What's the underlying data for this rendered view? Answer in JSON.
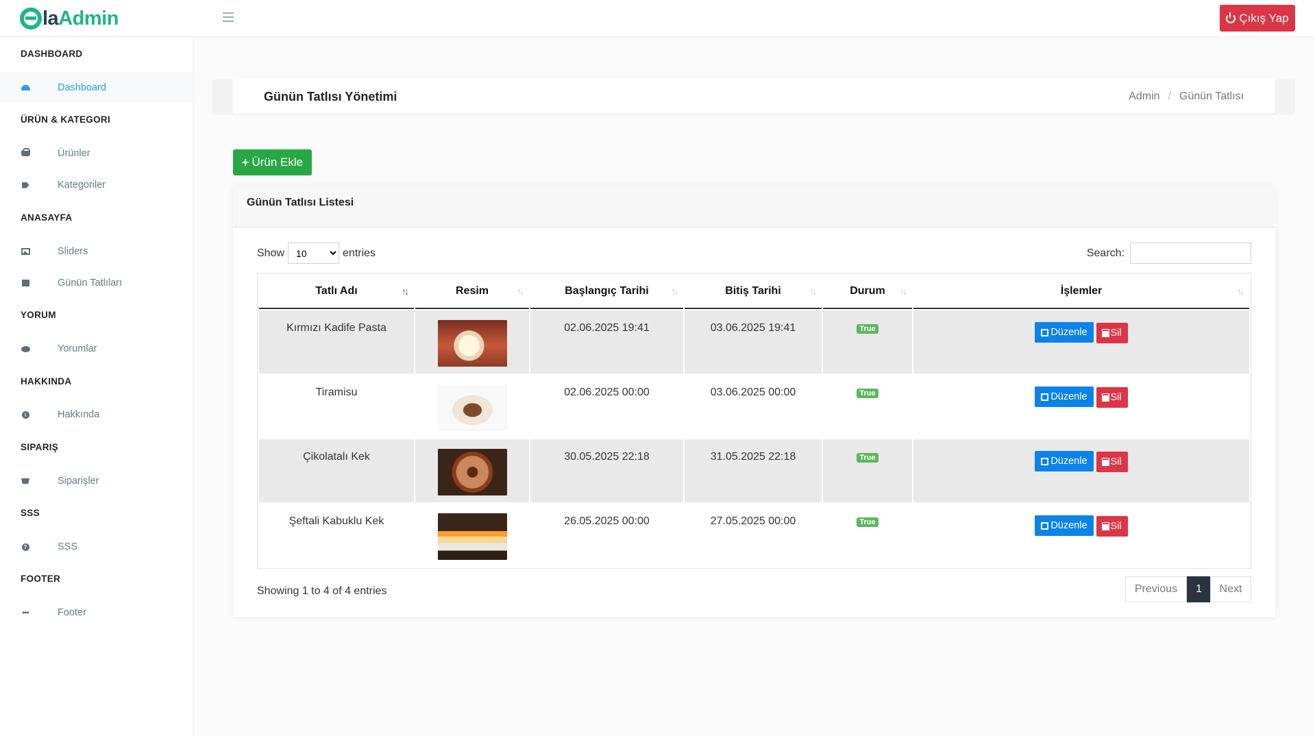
{
  "app": {
    "logo_la": "la",
    "logo_admin": "Admin",
    "logout_label": "Çıkış Yap"
  },
  "sidebar": {
    "sections": [
      {
        "caption": "DASHBOARD",
        "items": [
          {
            "label": "Dashboard",
            "icon": "gauge-icon",
            "active": true
          }
        ]
      },
      {
        "caption": "ÜRÜN & KATEGORI",
        "items": [
          {
            "label": "Ürünler",
            "icon": "basket-icon"
          },
          {
            "label": "Kategoriler",
            "icon": "tags-icon"
          }
        ]
      },
      {
        "caption": "ANASAYFA",
        "items": [
          {
            "label": "Sliders",
            "icon": "image-icon"
          },
          {
            "label": "Günün Tatlıları",
            "icon": "gift-icon"
          }
        ]
      },
      {
        "caption": "YORUM",
        "items": [
          {
            "label": "Yorumlar",
            "icon": "comments-icon"
          }
        ]
      },
      {
        "caption": "HAKKINDA",
        "items": [
          {
            "label": "Hakkında",
            "icon": "info-icon"
          }
        ]
      },
      {
        "caption": "SIPARIŞ",
        "items": [
          {
            "label": "Siparişler",
            "icon": "cart-icon"
          }
        ]
      },
      {
        "caption": "SSS",
        "items": [
          {
            "label": "SSS",
            "icon": "question-icon"
          }
        ]
      },
      {
        "caption": "FOOTER",
        "items": [
          {
            "label": "Footer",
            "icon": "ellipsis-icon"
          }
        ]
      }
    ]
  },
  "page": {
    "title": "Günün Tatlısı Yönetimi",
    "breadcrumb": [
      "Admin",
      "Günün Tatlısı"
    ],
    "add_button": "Ürün Ekle",
    "card_title": "Günün Tatlısı Listesi"
  },
  "datatable": {
    "show_label": "Show",
    "entries_label": "entries",
    "length_value": "10",
    "search_label": "Search:",
    "search_value": "",
    "columns": [
      "Tatlı Adı",
      "Resim",
      "Başlangıç Tarihi",
      "Bitiş Tarihi",
      "Durum",
      "İşlemler"
    ],
    "rows": [
      {
        "name": "Kırmızı Kadife Pasta",
        "start": "02.06.2025 19:41",
        "end": "03.06.2025 19:41",
        "status": "True"
      },
      {
        "name": "Tiramisu",
        "start": "02.06.2025 00:00",
        "end": "03.06.2025 00:00",
        "status": "True"
      },
      {
        "name": "Çikolatalı Kek",
        "start": "30.05.2025 22:18",
        "end": "31.05.2025 22:18",
        "status": "True"
      },
      {
        "name": "Şeftali Kabuklu Kek",
        "start": "26.05.2025 00:00",
        "end": "27.05.2025 00:00",
        "status": "True"
      }
    ],
    "edit_label": "Düzenle",
    "delete_label": "Sil",
    "info": "Showing 1 to 4 of 4 entries",
    "pager": {
      "previous": "Previous",
      "current": "1",
      "next": "Next"
    }
  },
  "colors": {
    "brand": "#1fb587",
    "danger": "#dc3545",
    "success": "#28a745",
    "primary": "#0d83e8",
    "active_link": "#26a2e6"
  }
}
